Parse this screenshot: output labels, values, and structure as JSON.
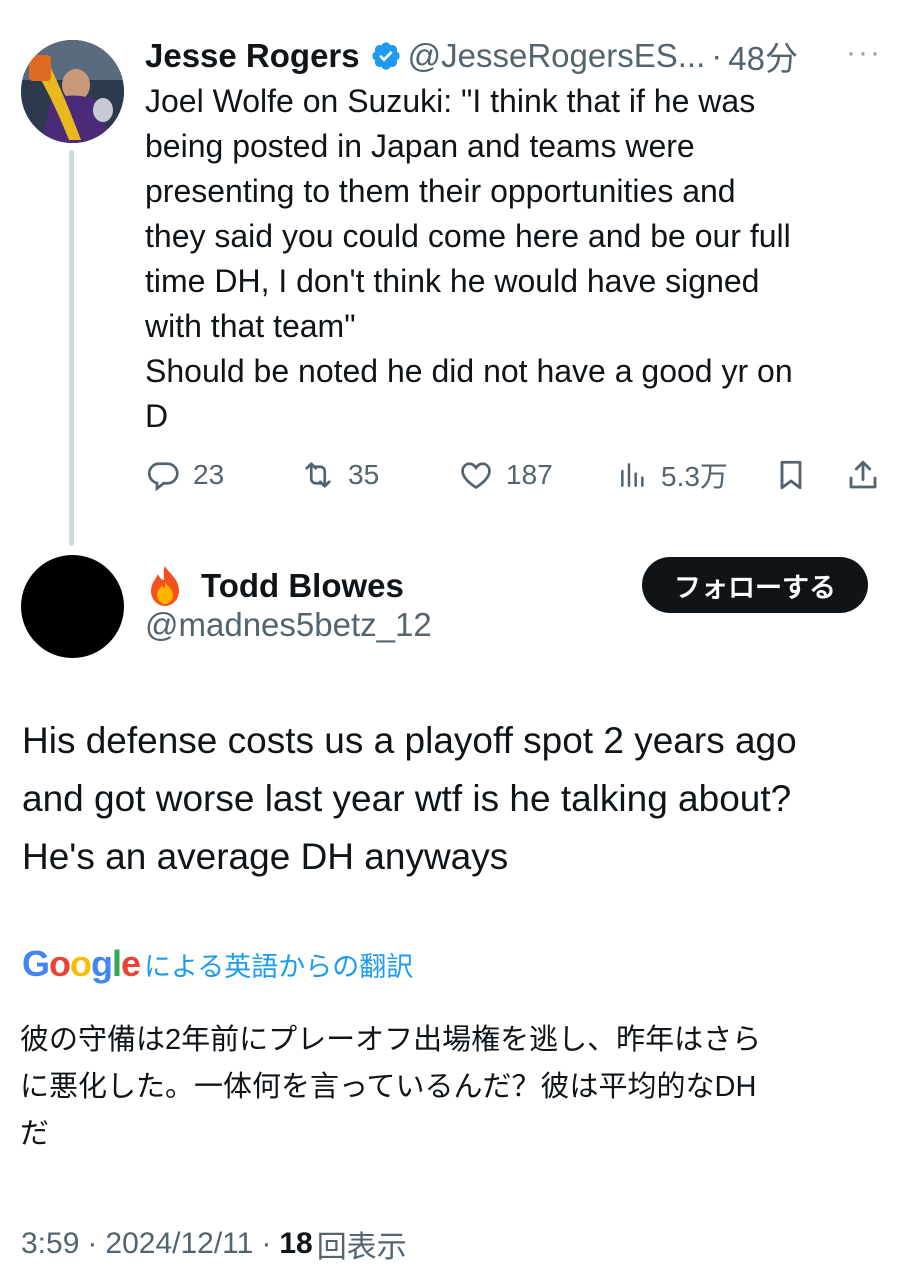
{
  "parent_tweet": {
    "author_name": "Jesse Rogers",
    "author_handle": "@JesseRogersES...",
    "separator": "·",
    "time": "48分",
    "more": "···",
    "text": "Joel Wolfe on Suzuki: \"I think that if he was\nbeing posted in Japan and teams were\npresenting to them their opportunities and\nthey said you could come here and be our full\ntime DH, I don't think he would have signed\nwith that team\"\nShould be noted he did not have a good yr on\nD",
    "replies": "23",
    "retweets": "35",
    "likes": "187",
    "views": "5.3万"
  },
  "reply_tweet": {
    "author_name": "Todd Blowes",
    "author_handle": "@madnes5betz_12",
    "follow_label": "フォローする",
    "text": "His defense costs us a playoff spot 2 years ago\nand got worse last year wtf is he talking about?\nHe's an average DH anyways",
    "translation_label": "による英語からの翻訳",
    "google_logo": "Google",
    "translated_text": "彼の守備は2年前にプレーオフ出場権を逃し、昨年はさら\nに悪化した。一体何を言っているんだ？彼は平均的なDH\nだ",
    "time": "3:59",
    "date": "2024/12/11",
    "separator": "·",
    "view_count": "18",
    "view_label": "回表示"
  },
  "colors": {
    "text_primary": "#0f1419",
    "text_secondary": "#536471",
    "link_blue": "#1d9bf0",
    "verified_blue": "#1d9bf0",
    "thread_line": "#cfd9de",
    "follow_button_bg": "#0f1419"
  }
}
